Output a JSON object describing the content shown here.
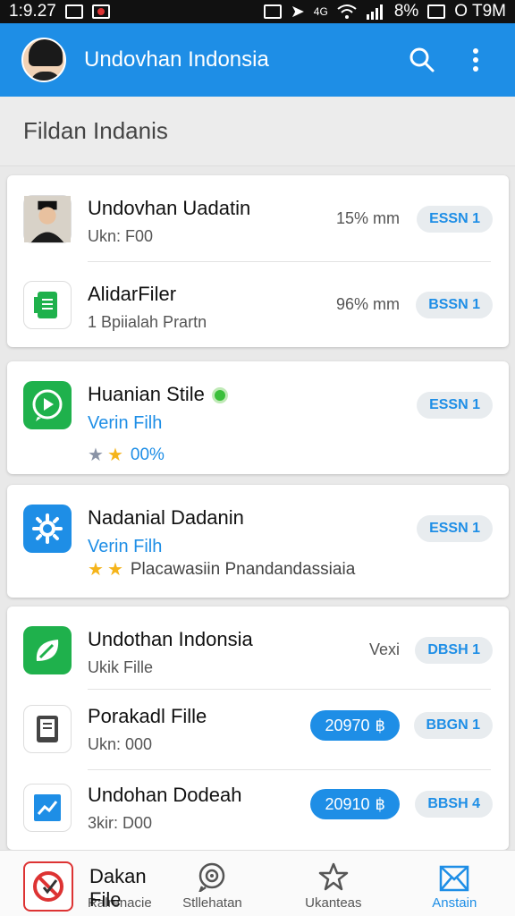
{
  "status_bar": {
    "time": "1:9.27",
    "signal_label": "4G",
    "battery": "8%",
    "right_text": "O T9M"
  },
  "app_bar": {
    "title": "Undovhan Indonsia",
    "avatar_icon": "user-avatar",
    "search_icon": "search-icon",
    "menu_icon": "more-vert-icon",
    "color": "#1e8ee6"
  },
  "section": {
    "title": "Fildan Indanis"
  },
  "cards": [
    {
      "rows": [
        {
          "title": "Undovhan Uadatin",
          "subtitle": "Ukn: F00",
          "meta": "15% mm",
          "chip": "ESSN 1",
          "icon": "person-photo-icon"
        },
        {
          "title": "AlidarFiler",
          "subtitle": "1 Bpiialah Prartn",
          "meta": "96% mm",
          "chip": "BSSN 1",
          "icon": "document-icon"
        }
      ]
    },
    {
      "rows": [
        {
          "title": "Huanian Stile",
          "subtitle": "Verin Filh",
          "rating_value": "00%",
          "chip": "ESSN 1",
          "icon": "play-icon"
        }
      ]
    },
    {
      "rows": [
        {
          "title": "Nadanial Dadanin",
          "subtitle": "Verin Filh",
          "rating_text": "Placawasiin Pnandandassiaia",
          "chip": "ESSN 1",
          "icon": "gear-icon"
        }
      ]
    },
    {
      "rows": [
        {
          "title": "Undothan Indonsia",
          "subtitle": "Ukik Fille",
          "meta": "Vexi",
          "chip": "DBSH 1",
          "icon": "leaf-icon"
        },
        {
          "title": "Porakadl Fille",
          "subtitle": "Ukn: 000",
          "pill": "20970",
          "pill_icon": "currency-icon",
          "chip": "BBGN 1",
          "icon": "tablet-icon"
        },
        {
          "title": "Undohan Dodeah",
          "subtitle": "3kir: D00",
          "pill": "20910",
          "pill_icon": "currency-icon",
          "chip": "BBSH 4",
          "icon": "chart-icon"
        }
      ]
    }
  ],
  "bottom_nav": {
    "overlay_title": "Dakan File",
    "items": [
      {
        "label": "Ralrenacie",
        "icon": "no-entry-icon"
      },
      {
        "label": "Stllehatan",
        "icon": "target-chat-icon"
      },
      {
        "label": "Ukanteas",
        "icon": "star-outline-icon"
      },
      {
        "label": "Anstain",
        "icon": "mail-x-icon"
      }
    ]
  }
}
